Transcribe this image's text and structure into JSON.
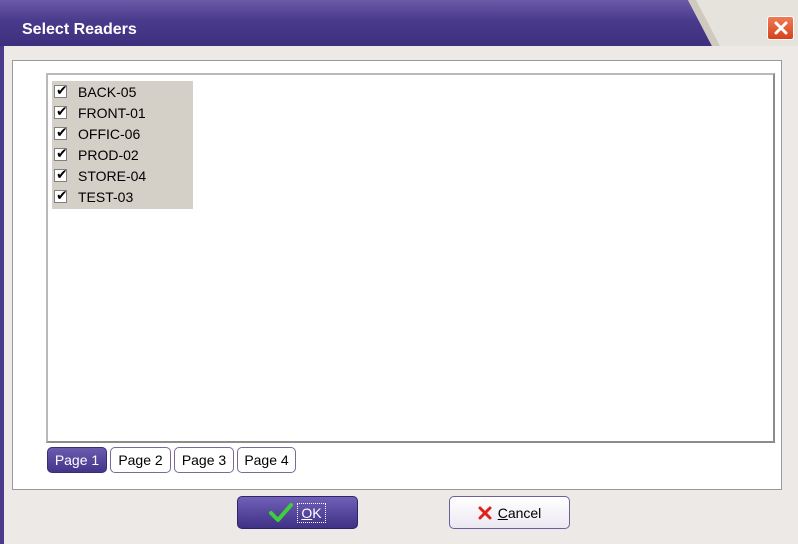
{
  "window": {
    "title": "Select Readers"
  },
  "readers": [
    {
      "label": "BACK-05",
      "checked": true
    },
    {
      "label": "FRONT-01",
      "checked": true
    },
    {
      "label": "OFFIC-06",
      "checked": true
    },
    {
      "label": "PROD-02",
      "checked": true
    },
    {
      "label": "STORE-04",
      "checked": true
    },
    {
      "label": "TEST-03",
      "checked": true
    }
  ],
  "tabs": [
    {
      "label": "Page 1",
      "active": true
    },
    {
      "label": "Page 2",
      "active": false
    },
    {
      "label": "Page 3",
      "active": false
    },
    {
      "label": "Page 4",
      "active": false
    }
  ],
  "buttons": {
    "ok_accel": "O",
    "ok_rest": "K",
    "cancel_accel": "C",
    "cancel_rest": "ancel"
  },
  "icons": {
    "close": "close-icon",
    "ok": "checkmark-icon",
    "cancel": "x-icon"
  },
  "colors": {
    "titlebar": "#4a3a8c",
    "close": "#d4431d",
    "accent": "#44358a"
  }
}
